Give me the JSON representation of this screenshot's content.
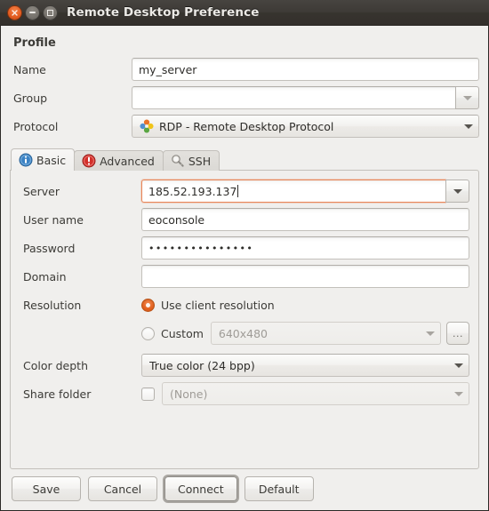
{
  "window": {
    "title": "Remote Desktop Preference",
    "buttons": {
      "close": "close-button",
      "minimize": "minimize-button",
      "maximize": "maximize-button"
    }
  },
  "profile": {
    "section_title": "Profile",
    "name": {
      "label": "Name",
      "value": "my_server",
      "placeholder": ""
    },
    "group": {
      "label": "Group",
      "value": "",
      "placeholder": ""
    },
    "protocol": {
      "label": "Protocol",
      "value": "RDP - Remote Desktop Protocol",
      "icon": "rdp-icon"
    }
  },
  "tabs": [
    {
      "label": "Basic",
      "icon": "info-icon",
      "active": true
    },
    {
      "label": "Advanced",
      "icon": "warning-icon",
      "active": false
    },
    {
      "label": "SSH",
      "icon": "key-icon",
      "active": false
    }
  ],
  "basic": {
    "server": {
      "label": "Server",
      "value": "185.52.193.137",
      "focused": true
    },
    "username": {
      "label": "User name",
      "value": "eoconsole"
    },
    "password": {
      "label": "Password",
      "value": "•••••••••••••••"
    },
    "domain": {
      "label": "Domain",
      "value": ""
    },
    "resolution": {
      "label": "Resolution",
      "option_client": "Use client resolution",
      "option_custom": "Custom",
      "custom_value": "640x480",
      "selected": "Use client resolution",
      "more_button": "..."
    },
    "color_depth": {
      "label": "Color depth",
      "value": "True color (24 bpp)"
    },
    "share_folder": {
      "label": "Share folder",
      "value": "(None)",
      "checked": false
    }
  },
  "actions": {
    "save": "Save",
    "cancel": "Cancel",
    "connect": "Connect",
    "default": "Default"
  },
  "colors": {
    "accent": "#e2601f",
    "titlebar": "#3d3a36",
    "dialog_bg": "#f0efed",
    "focus_border": "#e8875a"
  }
}
